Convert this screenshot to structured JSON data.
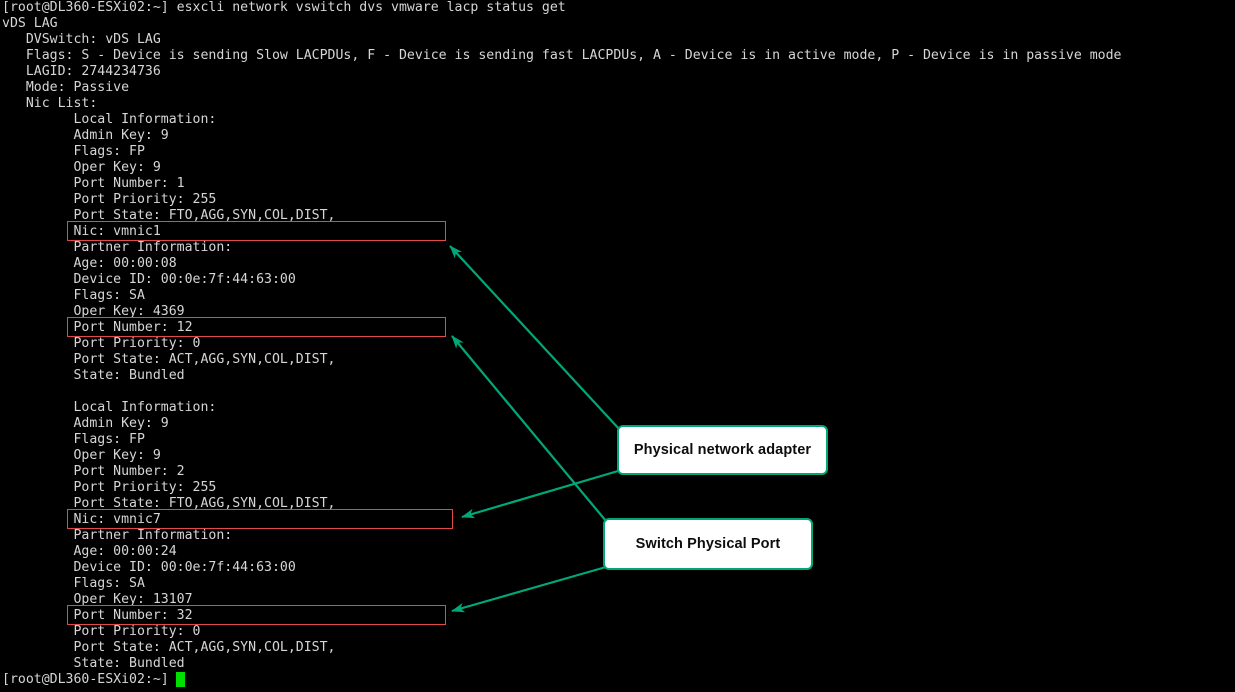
{
  "terminal": {
    "background_color": "#000000",
    "text_color": "#d6d6d6",
    "cursor_color": "#00e000",
    "prompt": "[root@DL360-ESXi02:~]",
    "command": "esxcli network vswitch dvs vmware lacp status get",
    "lines": [
      "[root@DL360-ESXi02:~] esxcli network vswitch dvs vmware lacp status get",
      "vDS LAG",
      "   DVSwitch: vDS LAG",
      "   Flags: S - Device is sending Slow LACPDUs, F - Device is sending fast LACPDUs, A - Device is in active mode, P - Device is in passive mode",
      "   LAGID: 2744234736",
      "   Mode: Passive",
      "   Nic List:",
      "         Local Information:",
      "         Admin Key: 9",
      "         Flags: FP",
      "         Oper Key: 9",
      "         Port Number: 1",
      "         Port Priority: 255",
      "         Port State: FTO,AGG,SYN,COL,DIST,",
      "         Nic: vmnic1",
      "         Partner Information:",
      "         Age: 00:00:08",
      "         Device ID: 00:0e:7f:44:63:00",
      "         Flags: SA",
      "         Oper Key: 4369",
      "         Port Number: 12",
      "         Port Priority: 0",
      "         Port State: ACT,AGG,SYN,COL,DIST,",
      "         State: Bundled",
      "",
      "         Local Information:",
      "         Admin Key: 9",
      "         Flags: FP",
      "         Oper Key: 9",
      "         Port Number: 2",
      "         Port Priority: 255",
      "         Port State: FTO,AGG,SYN,COL,DIST,",
      "         Nic: vmnic7",
      "         Partner Information:",
      "         Age: 00:00:24",
      "         Device ID: 00:0e:7f:44:63:00",
      "         Flags: SA",
      "         Oper Key: 13107",
      "         Port Number: 32",
      "         Port Priority: 0",
      "         Port State: ACT,AGG,SYN,COL,DIST,",
      "         State: Bundled",
      "[root@DL360-ESXi02:~]"
    ]
  },
  "highlights": {
    "color": "#e04a4a",
    "boxes": [
      {
        "label": "nic-vmnic1-highlight",
        "target_text": "Nic: vmnic1"
      },
      {
        "label": "partner-port-number-12-highlight",
        "target_text": "Port Number: 12"
      },
      {
        "label": "nic-vmnic7-highlight",
        "target_text": "Nic: vmnic7"
      },
      {
        "label": "partner-port-number-32-highlight",
        "target_text": "Port Number: 32"
      }
    ]
  },
  "annotations": {
    "border_color": "#00a878",
    "fill_color": "#ffffff",
    "text_color": "#0d0d0d",
    "callouts": [
      {
        "label": "Physical network adapter"
      },
      {
        "label": "Switch Physical Port"
      }
    ]
  }
}
